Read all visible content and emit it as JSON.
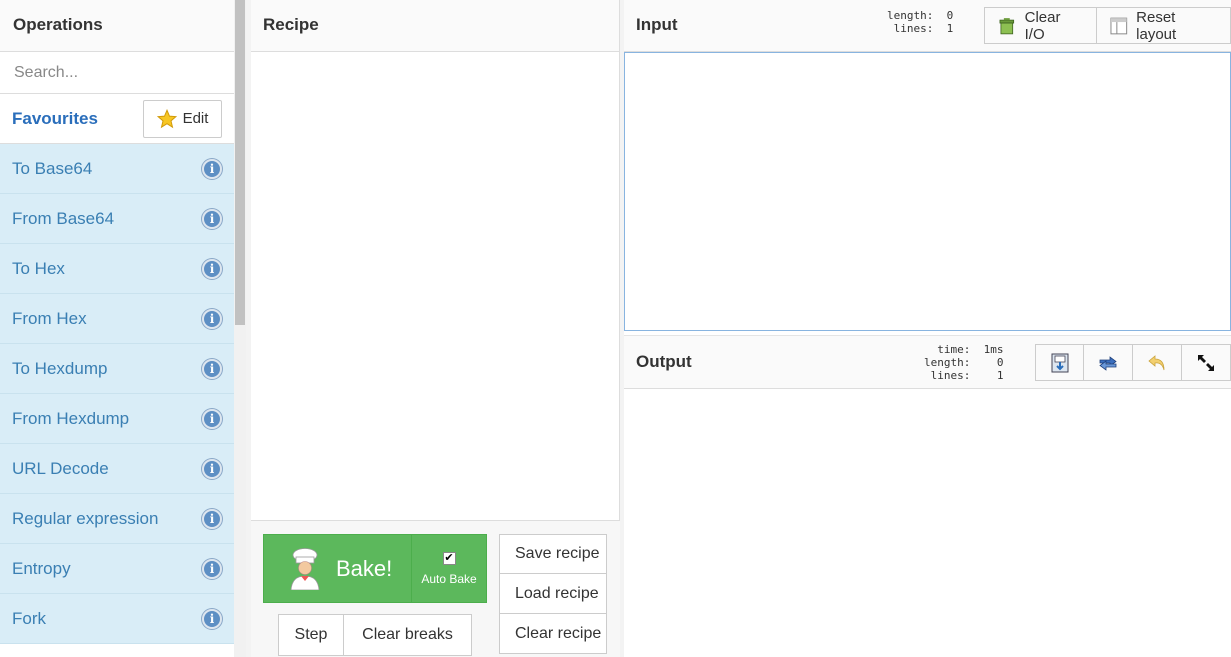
{
  "operations": {
    "title": "Operations",
    "search_placeholder": "Search...",
    "favourites_label": "Favourites",
    "edit_label": "Edit",
    "items": [
      {
        "label": "To Base64"
      },
      {
        "label": "From Base64"
      },
      {
        "label": "To Hex"
      },
      {
        "label": "From Hex"
      },
      {
        "label": "To Hexdump"
      },
      {
        "label": "From Hexdump"
      },
      {
        "label": "URL Decode"
      },
      {
        "label": "Regular expression"
      },
      {
        "label": "Entropy"
      },
      {
        "label": "Fork"
      }
    ]
  },
  "recipe": {
    "title": "Recipe",
    "bake_label": "Bake!",
    "auto_bake_label": "Auto Bake",
    "auto_bake_checked": true,
    "step_label": "Step",
    "clear_breaks_label": "Clear breaks",
    "save_label": "Save recipe",
    "load_label": "Load recipe",
    "clear_label": "Clear recipe"
  },
  "input": {
    "title": "Input",
    "info": "length:  0\n lines:  1",
    "clear_io_label": "Clear I/O",
    "reset_layout_label": "Reset layout"
  },
  "output": {
    "title": "Output",
    "info": "  time:  1ms\nlength:    0\n lines:    1"
  },
  "colors": {
    "accent": "#2a6ebb",
    "bake_green": "#5cb85c",
    "favourites_bg": "#d9edf7"
  }
}
